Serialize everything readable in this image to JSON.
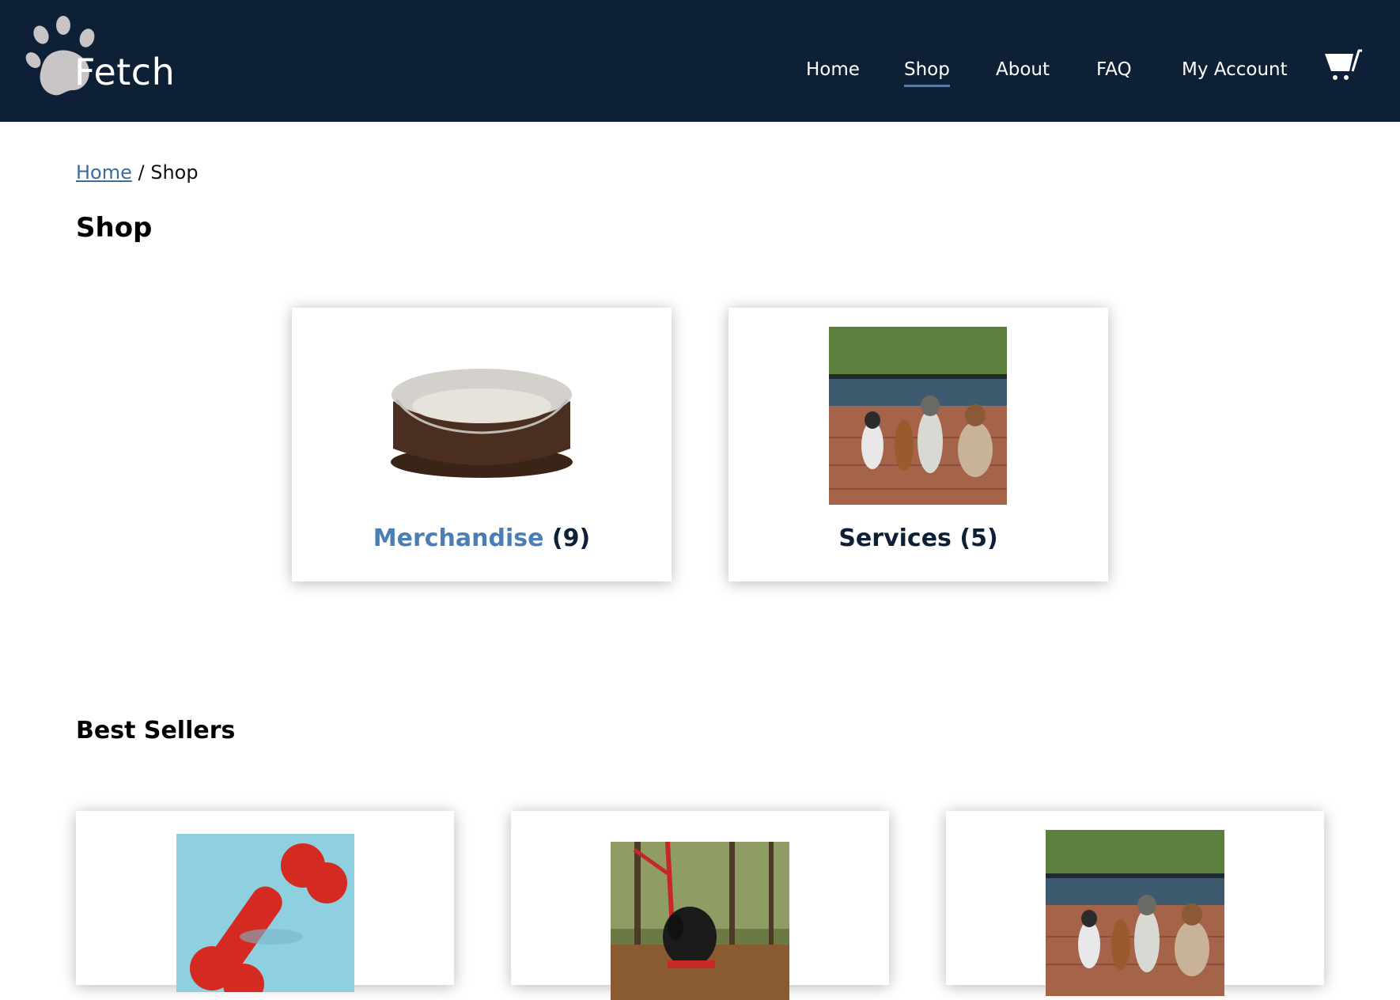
{
  "header": {
    "logo_text": "Fetch",
    "nav": [
      {
        "label": "Home",
        "active": false
      },
      {
        "label": "Shop",
        "active": true
      },
      {
        "label": "About",
        "active": false
      },
      {
        "label": "FAQ",
        "active": false
      },
      {
        "label": "My Account",
        "active": false
      }
    ],
    "colors": {
      "background": "#0e2035",
      "active_underline": "#4a7fb5"
    }
  },
  "breadcrumb": {
    "home_label": "Home",
    "separator": " / ",
    "current": "Shop"
  },
  "page_title": "Shop",
  "categories": [
    {
      "name": "Merchandise",
      "count": "(9)",
      "image": "dog-bed",
      "highlighted": true
    },
    {
      "name": "Services",
      "count": "(5)",
      "image": "dog-walking-photo",
      "highlighted": false
    }
  ],
  "best_sellers": {
    "title": "Best Sellers",
    "items": [
      {
        "image": "red-bone-toy"
      },
      {
        "image": "black-dog-leash-photo"
      },
      {
        "image": "dog-walking-photo"
      }
    ]
  },
  "icons": {
    "logo": "paw-icon",
    "cart": "cart-icon"
  }
}
